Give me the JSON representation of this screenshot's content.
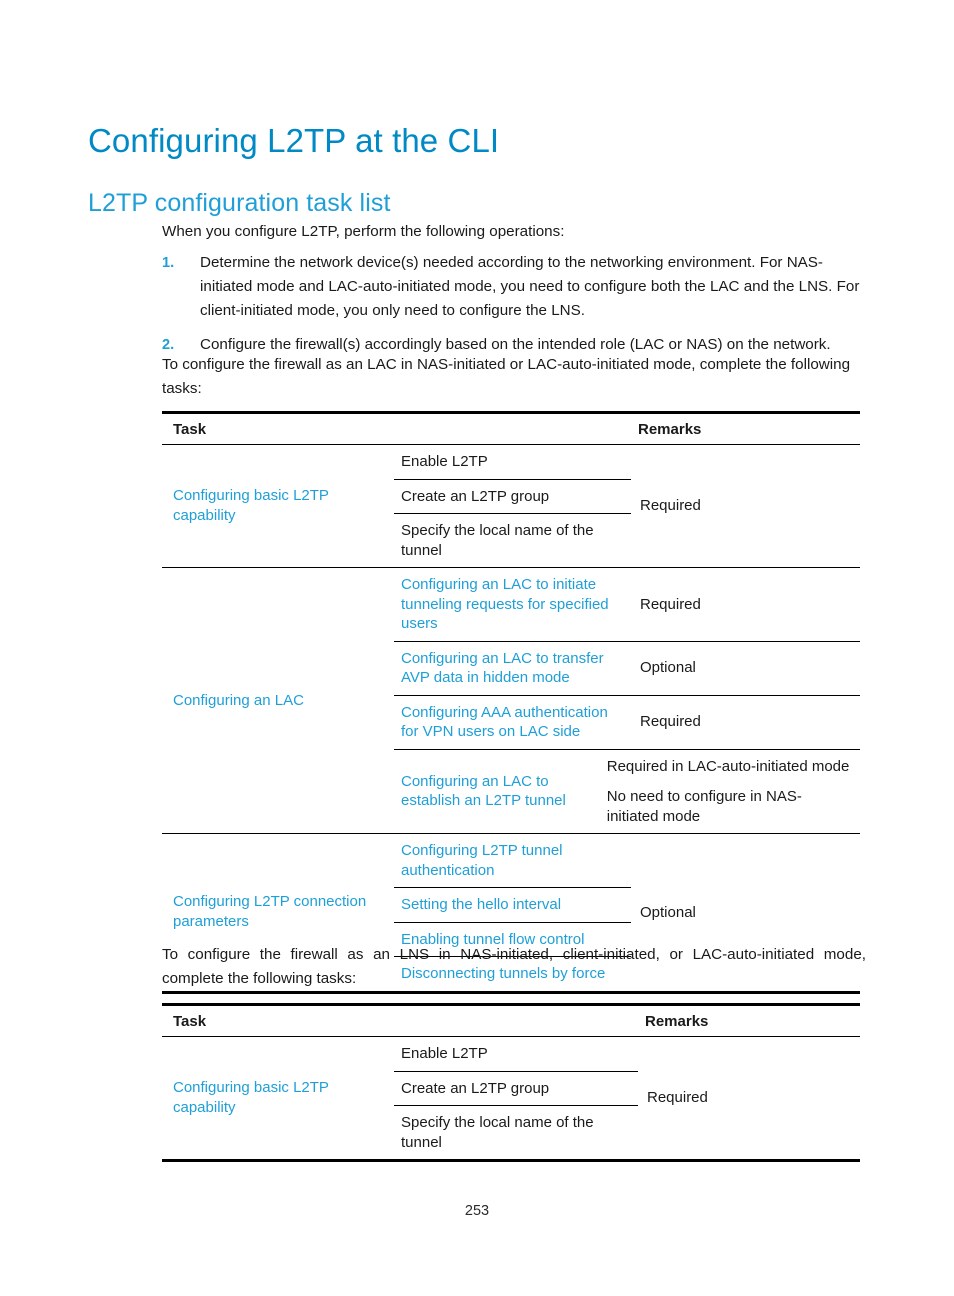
{
  "document": {
    "title": "Configuring L2TP at the CLI",
    "section_heading": "L2TP configuration task list",
    "page_number": "253"
  },
  "intro": {
    "lead": "When you configure L2TP, perform the following operations:",
    "steps": [
      {
        "num": "1.",
        "text": "Determine the network device(s) needed according to the networking environment. For NAS-initiated mode and LAC-auto-initiated mode, you need to configure both the LAC and the LNS. For client-initiated mode, you only need to configure the LNS."
      },
      {
        "num": "2.",
        "text": "Configure the firewall(s) accordingly based on the intended role (LAC or NAS) on the network."
      }
    ]
  },
  "table_lac": {
    "intro": "To configure the firewall as an LAC in NAS-initiated or LAC-auto-initiated mode, complete the following tasks:",
    "headers": {
      "task": "Task",
      "remarks": "Remarks"
    },
    "groups": [
      {
        "left": "Configuring basic L2TP capability",
        "left_is_link": true,
        "remark_span": "Required",
        "middle": [
          {
            "text": "Enable L2TP",
            "is_link": false
          },
          {
            "text": "Create an L2TP group",
            "is_link": false
          },
          {
            "text": "Specify the local name of the tunnel",
            "is_link": false
          }
        ]
      },
      {
        "left": "Configuring an LAC",
        "left_is_link": true,
        "rows": [
          {
            "middle": "Configuring an LAC to initiate tunneling requests for specified users",
            "middle_is_link": true,
            "remarks": [
              "Required"
            ]
          },
          {
            "middle": "Configuring an LAC to transfer AVP data in hidden mode",
            "middle_is_link": true,
            "remarks": [
              "Optional"
            ]
          },
          {
            "middle": "Configuring AAA authentication for VPN users on LAC side",
            "middle_is_link": true,
            "remarks": [
              "Required"
            ]
          },
          {
            "middle": "Configuring an LAC to establish an L2TP tunnel",
            "middle_is_link": true,
            "remarks": [
              "Required in LAC-auto-initiated mode",
              "No need to configure in NAS-initiated mode"
            ]
          }
        ]
      },
      {
        "left": "Configuring L2TP connection parameters",
        "left_is_link": true,
        "remark_span": "Optional",
        "middle": [
          {
            "text": "Configuring L2TP tunnel authentication",
            "is_link": true
          },
          {
            "text": "Setting the hello interval",
            "is_link": true
          },
          {
            "text": "Enabling tunnel flow control",
            "is_link": true
          },
          {
            "text": "Disconnecting tunnels by force",
            "is_link": true
          }
        ]
      }
    ]
  },
  "table_lns": {
    "intro": "To configure the firewall as an LNS in NAS-initiated, client-initiated, or LAC-auto-initiated mode, complete the following tasks:",
    "headers": {
      "task": "Task",
      "remarks": "Remarks"
    },
    "groups": [
      {
        "left": "Configuring basic L2TP capability",
        "left_is_link": true,
        "remark_span": "Required",
        "middle": [
          {
            "text": "Enable L2TP",
            "is_link": false
          },
          {
            "text": "Create an L2TP group",
            "is_link": false
          },
          {
            "text": "Specify the local name of the tunnel",
            "is_link": false
          }
        ]
      }
    ]
  },
  "colors": {
    "title_blue": "#0089c4",
    "link_blue": "#1f9fd8",
    "text_black": "#1a1a1a"
  }
}
